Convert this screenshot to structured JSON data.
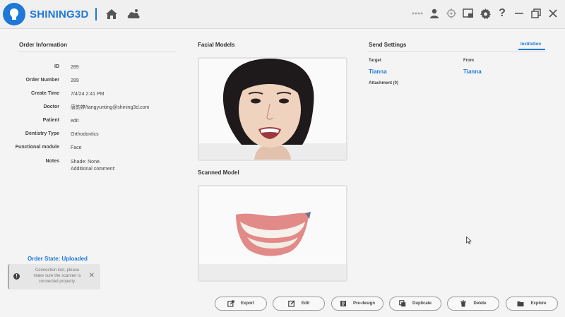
{
  "app": {
    "brand": "SHINING3D",
    "brand_color": "#1e78d7"
  },
  "header": {
    "icons_left": [
      "home-icon",
      "cloud-scan-icon"
    ],
    "icons_right": [
      "dots-icon",
      "user-icon",
      "target-icon",
      "screenshot-icon",
      "gear-icon",
      "help-icon",
      "minimize-icon",
      "restore-icon",
      "close-icon"
    ]
  },
  "order_info": {
    "title": "Order Information",
    "rows": [
      {
        "label": "ID",
        "value": "289"
      },
      {
        "label": "Order Number",
        "value": "289"
      },
      {
        "label": "Create Time",
        "value": "7/4/24 2:41 PM"
      },
      {
        "label": "Doctor",
        "value": "唐韵婷/tangyunting@shining3d.com"
      },
      {
        "label": "Patient",
        "value": "edit"
      },
      {
        "label": "Dentistry Type",
        "value": "Orthodontics"
      },
      {
        "label": "Functional module",
        "value": "Face"
      },
      {
        "label": "Notes",
        "value": "Shade: None.",
        "value2": "Additional comment:"
      }
    ]
  },
  "facial_models": {
    "title": "Facial Models"
  },
  "scanned_model": {
    "title": "Scanned Model"
  },
  "send_settings": {
    "title": "Send Settings",
    "tab": "Institution",
    "target_label": "Target",
    "target_value": "Tianna",
    "from_label": "From",
    "from_value": "Tianna",
    "attachment": "Attachment (0)"
  },
  "order_state": {
    "label": "Order State:",
    "value": "Uploaded"
  },
  "toast": {
    "line1": "Connection lost, please",
    "line2": "make sure the scanner is",
    "line3": "connected properly."
  },
  "actions": {
    "export": "Export",
    "edit": "Edit",
    "predesign": "Pre-design",
    "duplicate": "Duplicate",
    "delete": "Delete",
    "explore": "Explore"
  }
}
